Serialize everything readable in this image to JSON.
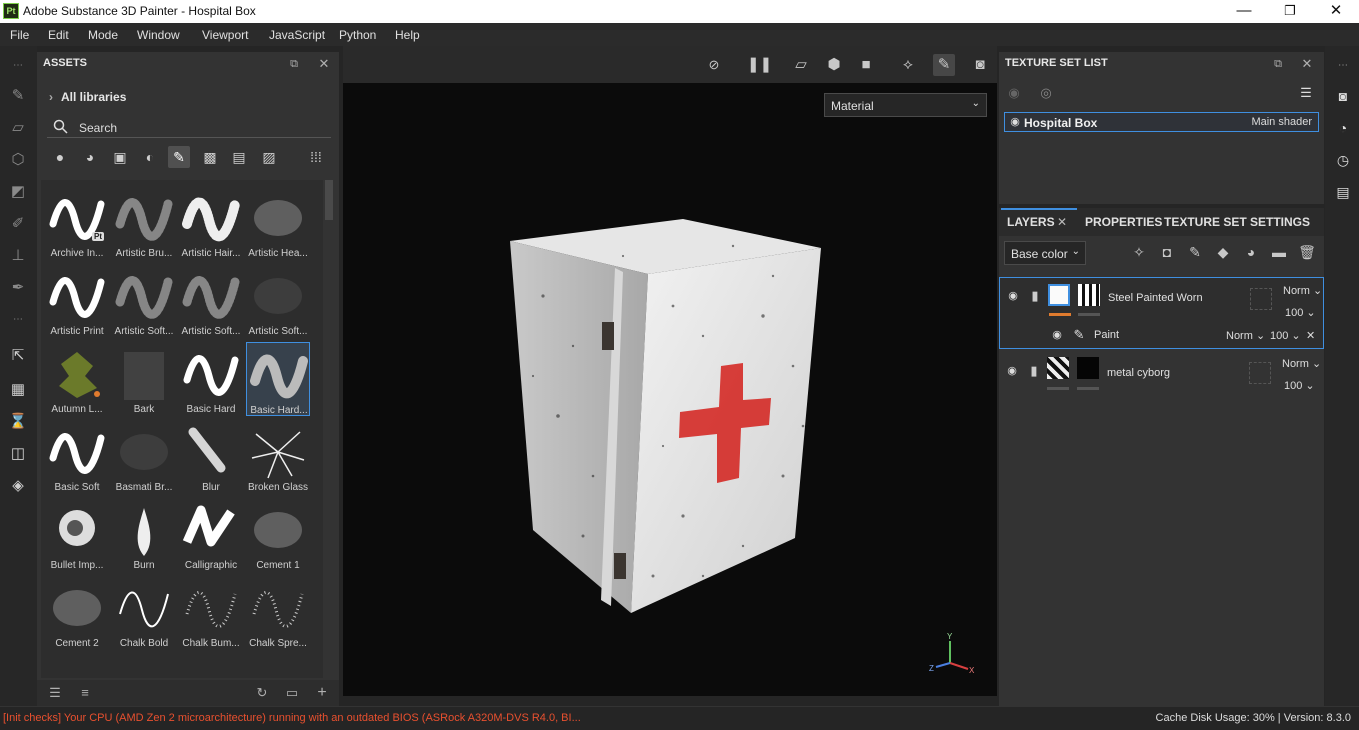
{
  "window": {
    "logo": "Pt",
    "title": "Adobe Substance 3D Painter - Hospital Box",
    "minimize": "—",
    "maximize": "❐",
    "close": "✕"
  },
  "menu": [
    "File",
    "Edit",
    "Mode",
    "Window",
    "Viewport",
    "JavaScript",
    "Python",
    "Help"
  ],
  "assets": {
    "title": "ASSETS",
    "library": "All libraries",
    "search_placeholder": "Search",
    "items": [
      "Archive In...",
      "Artistic Bru...",
      "Artistic Hair...",
      "Artistic Hea...",
      "Artistic Print",
      "Artistic Soft...",
      "Artistic Soft...",
      "Artistic Soft...",
      "Autumn L...",
      "Bark",
      "Basic Hard",
      "Basic Hard...",
      "Basic Soft",
      "Basmati Br...",
      "Blur",
      "Broken Glass",
      "Bullet Imp...",
      "Burn",
      "Calligraphic",
      "Cement 1",
      "Cement 2",
      "Chalk Bold",
      "Chalk Bum...",
      "Chalk Spre..."
    ],
    "selected_index": 11,
    "archive_badge": "Pt"
  },
  "viewport": {
    "display_mode": "Material",
    "axis_x": "X",
    "axis_y": "Y",
    "axis_z": "Z"
  },
  "texture_set_list": {
    "title": "TEXTURE SET LIST",
    "item_name": "Hospital Box",
    "item_shader": "Main shader"
  },
  "layers_panel": {
    "tabs": [
      "LAYERS",
      "PROPERTIES",
      "TEXTURE SET SETTINGS"
    ],
    "channel": "Base color",
    "layers": [
      {
        "name": "Steel Painted Worn",
        "blend": "Norm",
        "opacity": "100"
      },
      {
        "name": "Paint",
        "blend": "Norm",
        "opacity": "100"
      },
      {
        "name": "metal cyborg",
        "blend": "Norm",
        "opacity": "100"
      }
    ]
  },
  "status": {
    "message": "[Init checks] Your CPU (AMD Zen 2 microarchitecture) running with an outdated BIOS (ASRock A320M-DVS R4.0, BI...",
    "cache": "Cache Disk Usage:   30% | Version: 8.3.0"
  },
  "colors": {
    "accent": "#3f8fe0",
    "error": "#e8502f",
    "cross": "#d42a26",
    "layer_mark": "#e07b2e"
  }
}
